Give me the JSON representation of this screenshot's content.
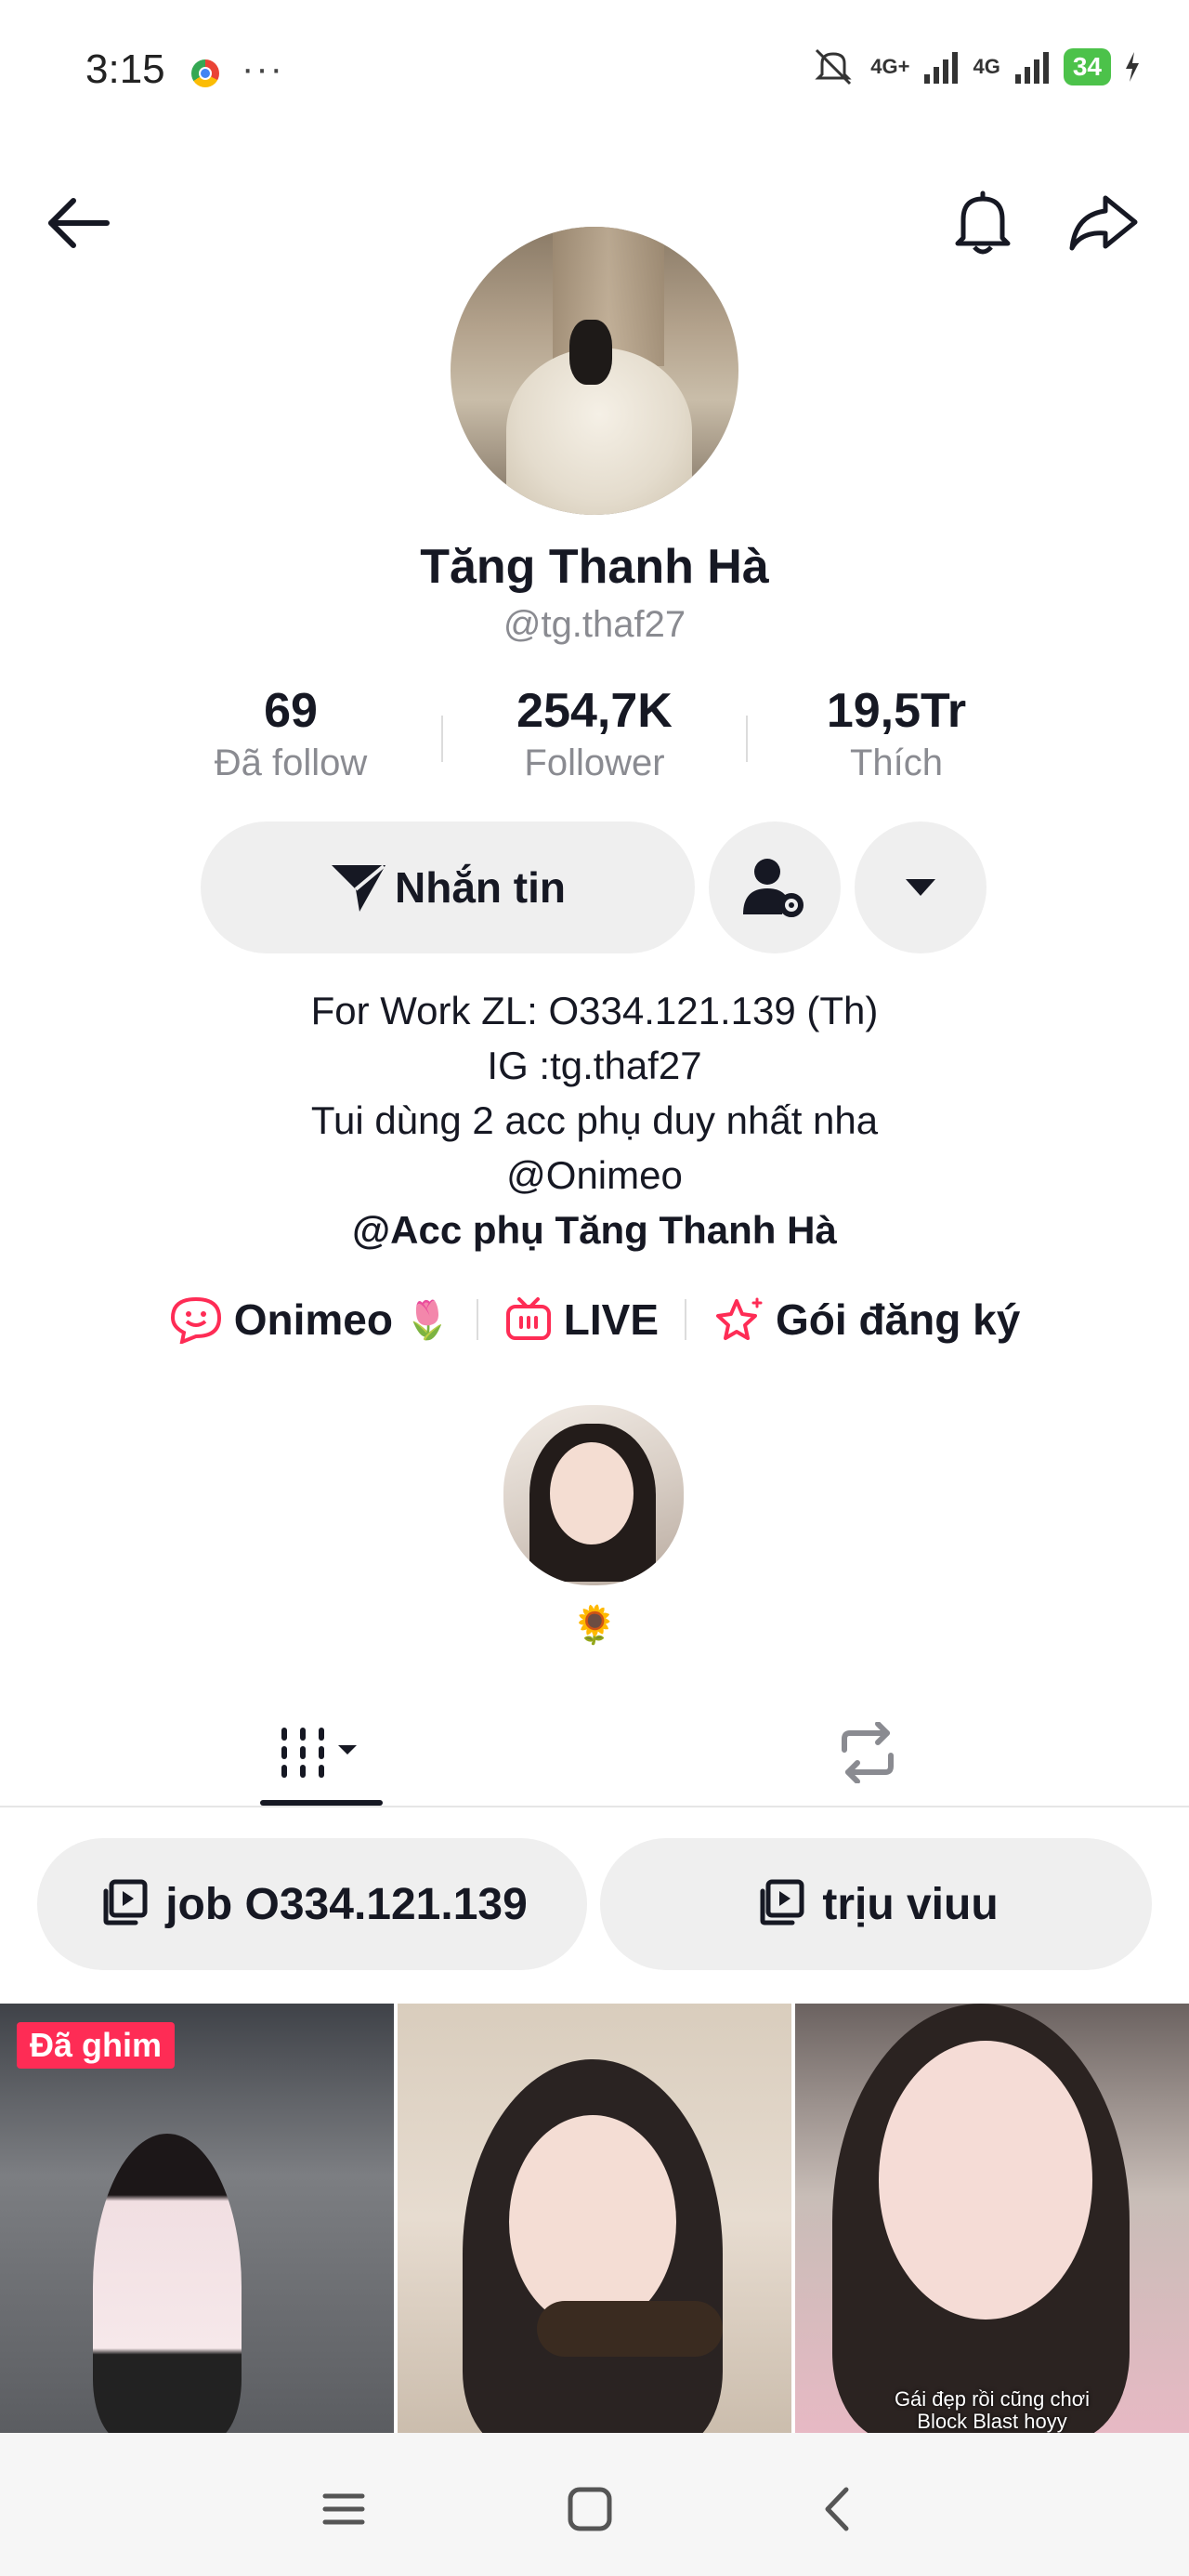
{
  "status_bar": {
    "time": "3:15",
    "more": "···",
    "network1": "4G+",
    "network2": "4G",
    "battery": "34"
  },
  "profile": {
    "name": "Tăng Thanh Hà",
    "handle": "@tg.thaf27"
  },
  "stats": [
    {
      "value": "69",
      "label": "Đã follow"
    },
    {
      "value": "254,7K",
      "label": "Follower"
    },
    {
      "value": "19,5Tr",
      "label": "Thích"
    }
  ],
  "actions": {
    "message_label": "Nhắn tin"
  },
  "bio": {
    "line1": "For Work ZL: O334.121.139 (Th)",
    "line2": "IG :tg.thaf27",
    "line3": "Tui dùng 2 acc phụ duy nhất nha",
    "line4": "@Onimeo",
    "line5": "@Acc phụ Tăng Thanh Hà"
  },
  "links": {
    "onimeo": "Onimeo",
    "onimeo_emoji": "🌷",
    "live": "LIVE",
    "subscription": "Gói đăng ký"
  },
  "featured": {
    "emoji": "🌻"
  },
  "playlists": [
    {
      "label": "job O334.121.139"
    },
    {
      "label": "trịu viuu"
    }
  ],
  "videos": {
    "pinned_badge": "Đã ghim",
    "caption_line1": "Gái đẹp rồi cũng chơi",
    "caption_line2": "Block Blast hoyy"
  },
  "colors": {
    "accent": "#fe2c55",
    "battery": "#4cc24a",
    "button_bg": "#efefef"
  }
}
